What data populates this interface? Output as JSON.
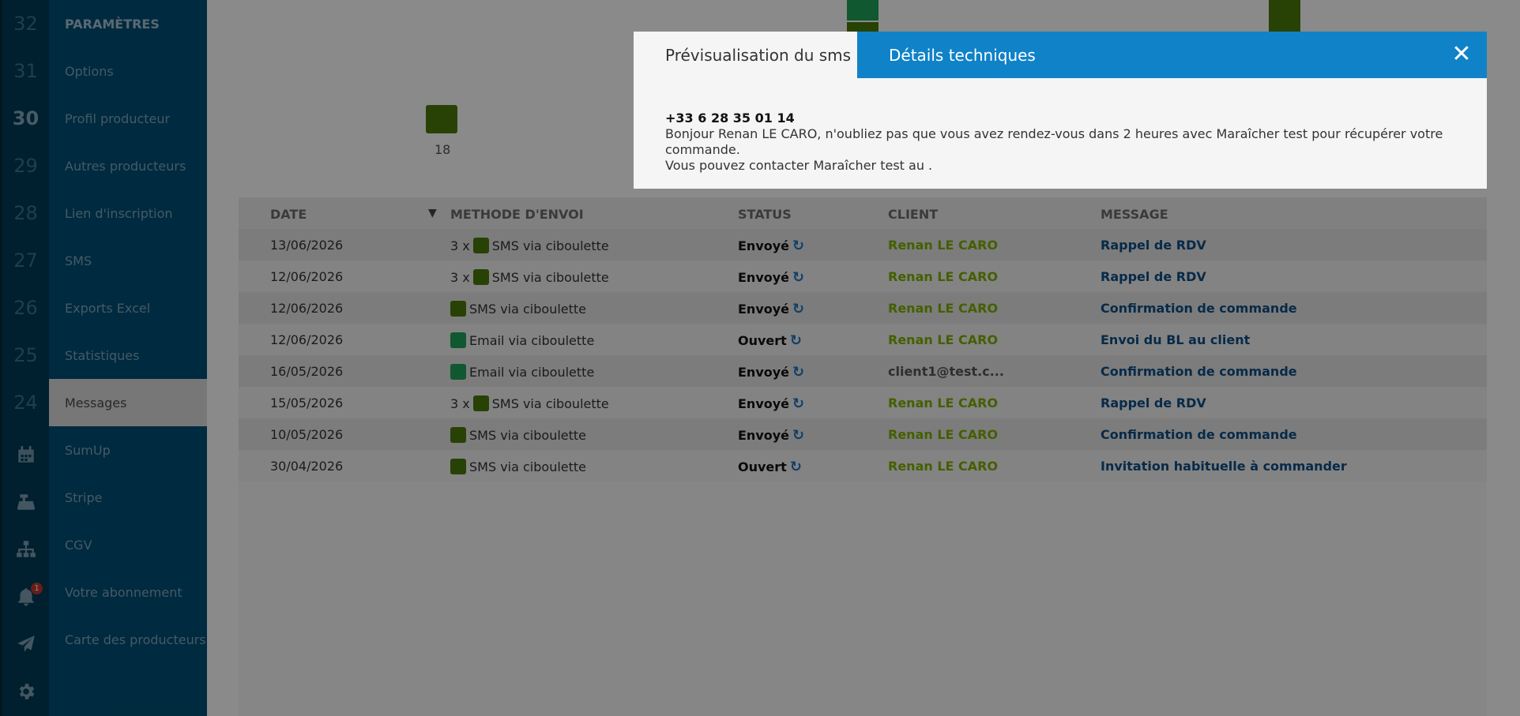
{
  "sidebar": {
    "rail_numbers": [
      "32",
      "31",
      "30",
      "29",
      "28",
      "27",
      "26",
      "25",
      "24"
    ],
    "rail_icons": [
      "calendar-icon",
      "cash-register-icon",
      "sitemap-icon",
      "bell-icon",
      "paper-plane-icon",
      "gear-icon"
    ],
    "notification_count": "1",
    "title": "PARAMÈTRES",
    "items": [
      "Options",
      "Profil producteur",
      "Autres producteurs",
      "Lien d'inscription",
      "SMS",
      "Exports Excel",
      "Statistiques",
      "Messages",
      "SumUp",
      "Stripe",
      "CGV",
      "Votre abonnement",
      "Carte des producteurs"
    ],
    "active_item": "Messages"
  },
  "background_chart": {
    "tick_label": "18",
    "colors": {
      "sms": "#4a7a0a",
      "email": "#1fa35a"
    }
  },
  "table": {
    "headers": {
      "date": "DATE",
      "method": "METHODE D'ENVOI",
      "status": "STATUS",
      "client": "CLIENT",
      "message": "MESSAGE"
    },
    "sort_arrow": "▼",
    "rows": [
      {
        "date": "13/06/2026",
        "multiplier": "3 x",
        "method_color": "#4a7a0a",
        "method": "SMS via ciboulette",
        "status": "Envoyé",
        "client": "Renan LE CARO",
        "client_type": "name",
        "message": "Rappel de RDV"
      },
      {
        "date": "12/06/2026",
        "multiplier": "3 x",
        "method_color": "#4a7a0a",
        "method": "SMS via ciboulette",
        "status": "Envoyé",
        "client": "Renan LE CARO",
        "client_type": "name",
        "message": "Rappel de RDV"
      },
      {
        "date": "12/06/2026",
        "multiplier": "",
        "method_color": "#4a7a0a",
        "method": "SMS via ciboulette",
        "status": "Envoyé",
        "client": "Renan LE CARO",
        "client_type": "name",
        "message": "Confirmation de commande"
      },
      {
        "date": "12/06/2026",
        "multiplier": "",
        "method_color": "#1fa35a",
        "method": "Email via ciboulette",
        "status": "Ouvert",
        "client": "Renan LE CARO",
        "client_type": "name",
        "message": "Envoi du BL au client"
      },
      {
        "date": "16/05/2026",
        "multiplier": "",
        "method_color": "#1fa35a",
        "method": "Email via ciboulette",
        "status": "Envoyé",
        "client": "client1@test.c...",
        "client_type": "email",
        "message": "Confirmation de commande"
      },
      {
        "date": "15/05/2026",
        "multiplier": "3 x",
        "method_color": "#4a7a0a",
        "method": "SMS via ciboulette",
        "status": "Envoyé",
        "client": "Renan LE CARO",
        "client_type": "name",
        "message": "Rappel de RDV"
      },
      {
        "date": "10/05/2026",
        "multiplier": "",
        "method_color": "#4a7a0a",
        "method": "SMS via ciboulette",
        "status": "Envoyé",
        "client": "Renan LE CARO",
        "client_type": "name",
        "message": "Confirmation de commande"
      },
      {
        "date": "30/04/2026",
        "multiplier": "",
        "method_color": "#4a7a0a",
        "method": "SMS via ciboulette",
        "status": "Ouvert",
        "client": "Renan LE CARO",
        "client_type": "name",
        "message": "Invitation habituelle à commander"
      }
    ]
  },
  "modal": {
    "tab_preview": "Prévisualisation du sms",
    "tab_technical": "Détails techniques",
    "close_symbol": "✕",
    "phone": "+33 6 28 35 01 14",
    "body_line1": "Bonjour Renan LE CARO, n'oubliez pas que vous avez rendez-vous dans 2 heures avec Maraîcher test pour récupérer votre commande.",
    "body_line2": "Vous pouvez contacter Maraîcher test au ."
  }
}
